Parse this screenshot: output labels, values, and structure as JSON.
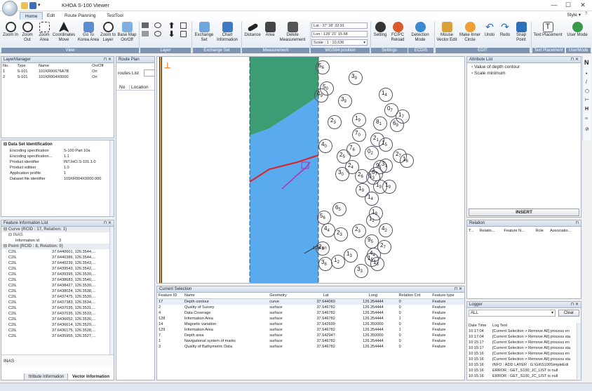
{
  "app": {
    "title": "KHOA S-100 Viewer",
    "style_menu": "Style"
  },
  "window_controls": {
    "minimize": "—",
    "maximize": "☐",
    "close": "✕"
  },
  "tabs": [
    "Home",
    "Edit",
    "Route Planning",
    "TestTool"
  ],
  "ribbon": {
    "view": {
      "label": "View",
      "buttons": [
        "Zoom In",
        "Zoom Out",
        "Zoom Area",
        "Coordinates Move",
        "Go To Korea Area",
        "Zoom to Layer",
        "Base Map On/Off"
      ]
    },
    "layer": {
      "label": "Layer"
    },
    "exchange": {
      "label": "Exchange Set",
      "buttons": [
        "Exchange Set",
        "Chart Information"
      ]
    },
    "measurement": {
      "label": "Measurement",
      "buttons": [
        "Distance",
        "Area",
        "Delete Measurement"
      ]
    },
    "wgs84": {
      "label": "WGS84 position",
      "lat": "Lat : 37' 38' 32.91",
      "lon": "Lon : 126' 21' 15.68",
      "scale": "Scale : 1 : 10,636"
    },
    "settings": {
      "label": "Settings",
      "buttons": [
        "Setting",
        "FC/PC Reload"
      ]
    },
    "ecdis": {
      "label": "ECDIS",
      "buttons": [
        "Detection Mode"
      ]
    },
    "edit": {
      "label": "EDIT",
      "buttons": [
        "Mouse Vector Edit",
        "Make Inner Circle",
        "Undo",
        "Redo",
        "Snap Point"
      ]
    },
    "text_placement": {
      "label": "Text Placement",
      "buttons": [
        "Text Placement"
      ]
    },
    "user_mode": {
      "label": "UserMode",
      "buttons": [
        "User Mode"
      ]
    }
  },
  "layer_manager": {
    "title": "LayerManager",
    "columns": [
      "No.",
      "Type",
      "Name",
      "On/Off"
    ],
    "rows": [
      [
        "1",
        "S-101",
        "101KR00676A7B",
        "On"
      ],
      [
        "2",
        "S-101",
        "101KR004X0000",
        "On"
      ]
    ]
  },
  "dataset_id": {
    "title": "Data Set Identification",
    "rows": [
      [
        "Encoding specification",
        "S-100 Part 10a"
      ],
      [
        "Encoding specification...",
        "1.1"
      ],
      [
        "Product identifier",
        "INT.IHO.S-101.1.0"
      ],
      [
        "Product edition",
        "1.0"
      ],
      [
        "Application profile",
        "1"
      ],
      [
        "Dataset file identifier",
        "101KR004X0000.000"
      ]
    ]
  },
  "feature_info": {
    "title": "Feature Information List",
    "group1": "Curve (RCID : 17, Relation: 1)",
    "sub1": "INAS",
    "attr": [
      "Information id",
      "3"
    ],
    "group2": "Point (RCID : 8, Relation: 0)",
    "rows": [
      [
        "C2IL",
        "37.6440601, 126.3544,..."
      ],
      [
        "C2IL",
        "37.6440386, 126.3544,..."
      ],
      [
        "C2IL",
        "37.6440239, 126.3543,..."
      ],
      [
        "C2IL",
        "37.6439543, 126.3542,..."
      ],
      [
        "C2IL",
        "37.6439395, 126.3539,..."
      ],
      [
        "C2IL",
        "37.6438683, 126.3540,..."
      ],
      [
        "C2IL",
        "37.6438427, 126.3539,..."
      ],
      [
        "C2IL",
        "37.6438024, 126.3538,..."
      ],
      [
        "C2IL",
        "37.6437475, 126.3539,..."
      ],
      [
        "C2IL",
        "37.6437383, 126.3534,..."
      ],
      [
        "C2IL",
        "37.6437035, 126.3531,..."
      ],
      [
        "C2IL",
        "37.6437035, 126.3533,..."
      ],
      [
        "C2IL",
        "37.6436652, 126.3530,..."
      ],
      [
        "C2IL",
        "37.6436614, 126.3529,..."
      ],
      [
        "C2IL",
        "37.6436175, 126.3528,..."
      ],
      [
        "C2IL",
        "37.6435955, 126.3527,..."
      ]
    ],
    "footer": "INAS",
    "bottom_tabs": [
      "ttribute Information",
      "Vector Information"
    ]
  },
  "route_plan": {
    "title": "Route Plan",
    "routes_label": "routes List",
    "columns": [
      "No",
      "Location"
    ]
  },
  "map": {
    "soundings": [
      [
        "5",
        "6",
        230,
        8
      ],
      [
        "3",
        "9",
        277,
        23
      ],
      [
        "5",
        "0",
        236,
        38
      ],
      [
        "4",
        "9",
        228,
        48
      ],
      [
        "3",
        "9",
        262,
        56
      ],
      [
        "1",
        "4",
        320,
        47
      ],
      [
        "2",
        "3",
        247,
        86
      ],
      [
        "1",
        "9",
        282,
        83
      ],
      [
        "0",
        "7",
        328,
        69
      ],
      [
        "8",
        "1",
        312,
        88
      ],
      [
        "6",
        "9",
        336,
        90
      ],
      [
        "1",
        "7",
        344,
        78
      ],
      [
        "7",
        "0",
        282,
        104
      ],
      [
        "2",
        "1",
        308,
        111
      ],
      [
        "4",
        "0",
        234,
        120
      ],
      [
        "7",
        "6",
        274,
        125
      ],
      [
        "2",
        "5",
        260,
        135
      ],
      [
        "0",
        "2",
        300,
        130
      ],
      [
        "1",
        "5",
        320,
        118
      ],
      [
        "2",
        "7",
        340,
        134
      ],
      [
        "1",
        "6",
        350,
        141
      ],
      [
        "9",
        "1",
        312,
        150
      ],
      [
        "6",
        "7",
        306,
        160
      ],
      [
        "3",
        "1",
        320,
        148
      ],
      [
        "1",
        "3",
        302,
        165
      ],
      [
        "2",
        "6",
        286,
        163
      ],
      [
        "3",
        "0",
        258,
        160
      ],
      [
        "2",
        "4",
        272,
        150
      ],
      [
        "1",
        "9",
        287,
        183
      ],
      [
        "1",
        "9",
        312,
        178
      ],
      [
        "1",
        "9",
        325,
        178
      ],
      [
        "1",
        "4",
        300,
        195
      ],
      [
        "6",
        "5",
        254,
        210
      ],
      [
        "1",
        "2",
        302,
        226
      ],
      [
        "1",
        "9",
        306,
        216
      ],
      [
        "5",
        "6",
        232,
        222
      ],
      [
        "4",
        "4",
        238,
        240
      ],
      [
        "4",
        "2",
        320,
        240
      ],
      [
        "2",
        "3",
        282,
        241
      ],
      [
        "2",
        "8",
        230,
        266
      ],
      [
        "9",
        "5",
        300,
        256
      ],
      [
        "2",
        "3",
        256,
        246
      ],
      [
        "2",
        "7",
        318,
        264
      ],
      [
        "1",
        "3",
        270,
        276
      ],
      [
        "4",
        "4",
        303,
        275
      ],
      [
        "1",
        "2",
        252,
        285
      ],
      [
        "3",
        "8",
        234,
        288
      ],
      [
        "3",
        "3",
        285,
        298
      ],
      [
        "1",
        "5",
        300,
        282
      ],
      [
        "1",
        "3",
        308,
        288
      ]
    ],
    "depth_label": "1.38 kn"
  },
  "attribute_list": {
    "title": "Attribute List",
    "items": [
      "Value of depth contour",
      "Scale minimum"
    ],
    "insert_label": "INSERT"
  },
  "relation": {
    "title": "Relation",
    "columns": [
      "T...",
      "Relatio...",
      "Feature N...",
      "Role",
      "Associatio..."
    ]
  },
  "current_selection": {
    "title": "Current Selection",
    "columns": [
      "Feature ID",
      "Name",
      "Geometry",
      "Lat",
      "Long",
      "Relation Cnt",
      "Feature type"
    ],
    "rows": [
      [
        "17",
        "Depth contour",
        "curve",
        "37.644060",
        "126.354444",
        "0",
        "Feature"
      ],
      [
        "2",
        "Quality of Survey",
        "surface",
        "37.646782",
        "126.354444",
        "0",
        "Feature"
      ],
      [
        "4",
        "Data Coverage",
        "surface",
        "37.646782",
        "126.354444",
        "0",
        "Feature"
      ],
      [
        "128",
        "Information Area",
        "surface",
        "37.646782",
        "126.354444",
        "1",
        "Feature"
      ],
      [
        "14",
        "Magnetic variation",
        "surface",
        "37.642699",
        "126.350000",
        "0",
        "Feature"
      ],
      [
        "129",
        "Information Area",
        "surface",
        "37.646782",
        "126.354444",
        "1",
        "Feature"
      ],
      [
        "7",
        "Depth area",
        "surface",
        "37.642947",
        "126.350000",
        "0",
        "Feature"
      ],
      [
        "1",
        "Navigational system of marks",
        "surface",
        "37.646782",
        "126.354444",
        "0",
        "Feature"
      ],
      [
        "3",
        "Quality of Bathymetric Data",
        "surface",
        "37.646782",
        "126.354444",
        "0",
        "Feature"
      ]
    ]
  },
  "logger": {
    "title": "Logger",
    "filter": "ALL",
    "clear_label": "Clear",
    "columns": [
      "Date Time",
      "Log Text"
    ],
    "rows": [
      [
        "10:17:04",
        "[Current Selection > Remove All] process en"
      ],
      [
        "10:17:04",
        "[Current Selection > Remove All] process sta"
      ],
      [
        "10:15:17",
        "[Current Selection > Remove All] process en"
      ],
      [
        "10:15:17",
        "[Current Selection > Remove All] process sta"
      ],
      [
        "10:15:16",
        "[Current Selection > Remove All] process en"
      ],
      [
        "10:15:16",
        "[Current Selection > Remove All] process sta"
      ],
      [
        "10:15:16",
        "INFO : ADD LAYER : G:\\Git\\S100SimpleEdi"
      ],
      [
        "10:15:16",
        "ERROR : GET_S100_JC_LIST is null"
      ],
      [
        "10:15:16",
        "ERROR : GET_S100_JC_LIST is null"
      ]
    ]
  },
  "colors": {
    "map_green": "#3c9c74",
    "map_blue": "#5aaaf0",
    "accent": "#2a5a9a",
    "route": "#e02020",
    "contour": "#b030b0"
  }
}
